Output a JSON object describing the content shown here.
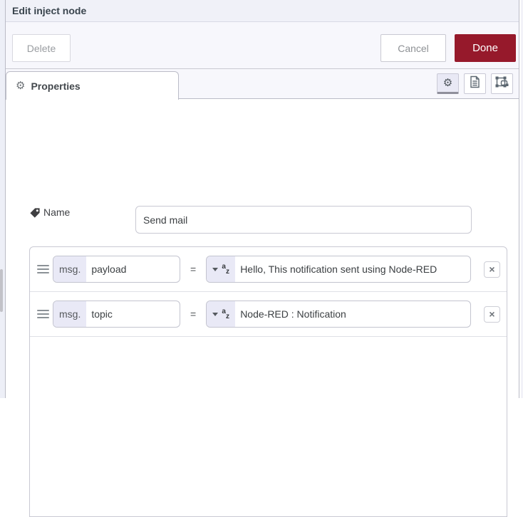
{
  "header": {
    "title": "Edit inject node"
  },
  "toolbar": {
    "delete_label": "Delete",
    "cancel_label": "Cancel",
    "done_label": "Done",
    "done_color": "#96192b"
  },
  "tabbar": {
    "properties_label": "Properties",
    "properties_icon": "gear-icon",
    "tool_icons": [
      "gear-icon",
      "description-icon",
      "appearance-icon"
    ]
  },
  "form": {
    "name_label": "Name",
    "name_value": "Send mail",
    "equals": "=",
    "remove_glyph": "×",
    "rows": [
      {
        "prefix": "msg.",
        "property": "payload",
        "type": "string (a-z)",
        "value": "Hello, This notification sent using Node-RED"
      },
      {
        "prefix": "msg.",
        "property": "topic",
        "type": "string (a-z)",
        "value": "Node-RED : Notification"
      }
    ]
  },
  "colors": {
    "accent_red": "#96192b",
    "lavender": "#e9e9f6",
    "header_bg": "#f0f1f8",
    "bar_bg": "#f7f7fc",
    "border": "#c9c9d3"
  },
  "glyphs": {
    "gear": "⚙"
  }
}
